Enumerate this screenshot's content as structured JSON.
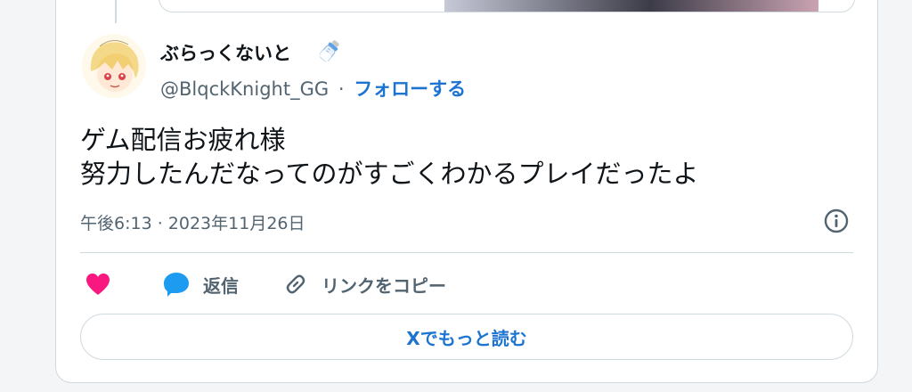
{
  "tweet": {
    "display_name": "ぶらっくないと",
    "name_emoji_icon": "baby-bottle-icon",
    "handle": "@BlqckKnight_GG",
    "separator": "·",
    "follow_label": "フォローする",
    "text_line1": "ゲム配信お疲れ様",
    "text_line2": "努力したんだなってのがすごくわかるプレイだったよ",
    "timestamp": "午後6:13 · 2023年11月26日"
  },
  "actions": {
    "heart_icon": "heart-icon",
    "reply_label": "返信",
    "copy_link_label": "リンクをコピー"
  },
  "read_more_label": "Xでもっと読む",
  "colors": {
    "accent": "#1d74d0",
    "heart": "#f91880",
    "reply": "#1d9bf0",
    "text_secondary": "#536471",
    "border": "#cfd9de"
  }
}
